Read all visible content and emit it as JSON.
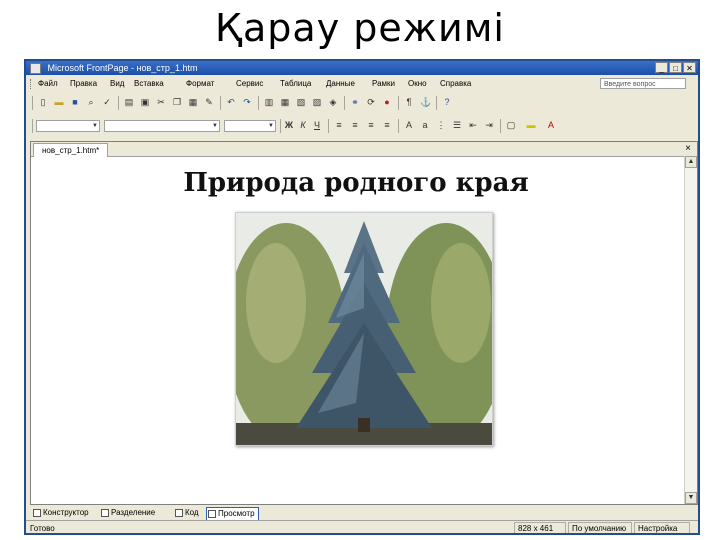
{
  "slide": {
    "title": "Қарау  режимі"
  },
  "window": {
    "title": "Microsoft FrontPage - нов_стр_1.htm",
    "buttons": [
      "_",
      "□",
      "✕"
    ]
  },
  "menu": {
    "items": [
      "Файл",
      "Правка",
      "Вид",
      "Вставка",
      "Формат",
      "Сервис",
      "Таблица",
      "Данные",
      "Рамки",
      "Окно",
      "Справка"
    ],
    "help_placeholder": "Введите вопрос"
  },
  "toolbar_icons": {
    "standard": [
      "new-icon",
      "open-icon",
      "save-icon",
      "find-icon",
      "spell-icon",
      "publish-icon",
      "preview-icon",
      "cut-icon",
      "copy-icon",
      "paste-icon",
      "format-painter-icon",
      "undo-icon",
      "redo-icon",
      "web-component-icon",
      "table-icon",
      "picture-icon",
      "chart-icon",
      "drawing-icon",
      "hyperlink-icon",
      "refresh-icon",
      "stop-icon",
      "show-all-icon",
      "anchor-icon",
      "help-icon"
    ],
    "formatting": [
      "bold-icon",
      "italic-icon",
      "underline-icon",
      "align-left-icon",
      "align-center-icon",
      "align-right-icon",
      "justify-icon",
      "grow-font-icon",
      "shrink-font-icon",
      "numbering-icon",
      "bullets-icon",
      "outdent-icon",
      "indent-icon",
      "border-icon",
      "highlight-icon",
      "font-color-icon"
    ]
  },
  "document": {
    "tab_label": "нов_стр_1.htm*",
    "heading": "Природа родного края",
    "image_alt": "blue-spruce-photo"
  },
  "view_tabs": [
    "Конструктор",
    "Разделение",
    "Код",
    "Просмотр"
  ],
  "active_view": "Просмотр",
  "status": {
    "left": "Готово",
    "size": "828 x 461",
    "mode": "По умолчанию",
    "custom": "Настройка"
  },
  "colors": {
    "titlebar": "#1b4fa8",
    "chrome": "#ece9d8",
    "active_tab_border": "#2a5fb0"
  }
}
